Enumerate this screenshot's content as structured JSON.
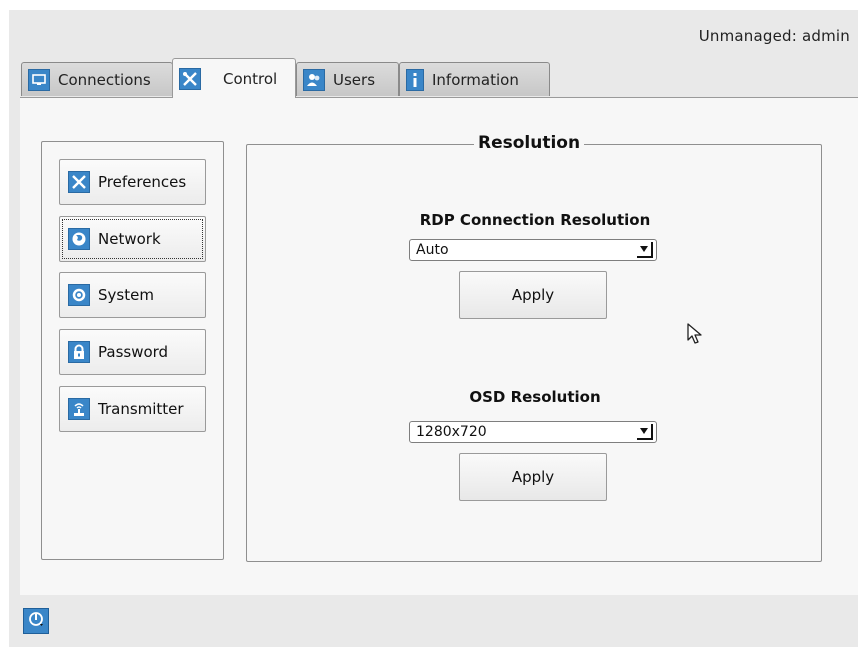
{
  "header": {
    "user_status": "Unmanaged: admin"
  },
  "tabs": [
    {
      "label": "Connections",
      "icon": "monitor-icon",
      "active": false
    },
    {
      "label": "Control",
      "icon": "tools-icon",
      "active": true
    },
    {
      "label": "Users",
      "icon": "users-icon",
      "active": false
    },
    {
      "label": "Information",
      "icon": "info-icon",
      "active": false
    }
  ],
  "sidebar": {
    "items": [
      {
        "label": "Preferences",
        "icon": "tools-icon"
      },
      {
        "label": "Network",
        "icon": "globe-icon",
        "focused": true
      },
      {
        "label": "System",
        "icon": "gear-icon"
      },
      {
        "label": "Password",
        "icon": "lock-icon"
      },
      {
        "label": "Transmitter",
        "icon": "transmitter-icon"
      }
    ]
  },
  "main": {
    "title": "Resolution",
    "rdp": {
      "label": "RDP Connection Resolution",
      "value": "Auto",
      "apply_label": "Apply"
    },
    "osd": {
      "label": "OSD Resolution",
      "value": "1280x720",
      "apply_label": "Apply"
    }
  },
  "footer": {
    "power_icon": "power-icon"
  },
  "colors": {
    "accent": "#3a86c8",
    "background": "#e9e9e9",
    "panel": "#f7f7f7"
  }
}
